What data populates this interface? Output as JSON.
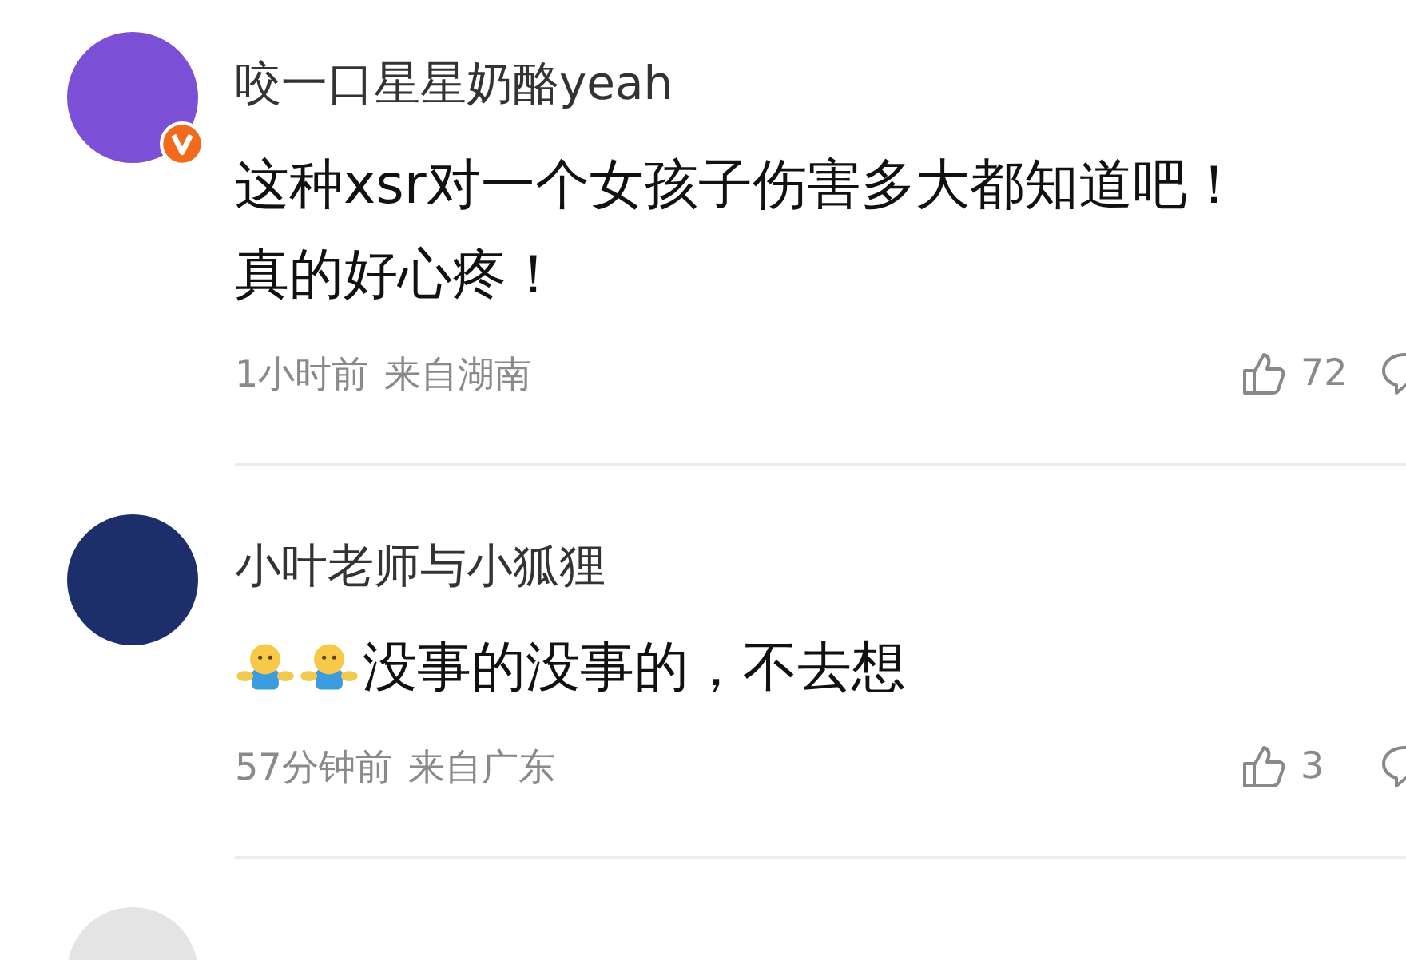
{
  "comments": [
    {
      "name": "咬一口星星奶酪yeah",
      "verified": true,
      "content_lines": [
        [
          {
            "kind": "text",
            "text": "这种xsr对一个女孩子伤害多大都知道吧！"
          }
        ],
        [
          {
            "kind": "text",
            "text": "真的好心疼！"
          }
        ]
      ],
      "time": "1小时前",
      "location": "来自湖南",
      "likes": "72"
    },
    {
      "name": "小叶老师与小狐狸",
      "verified": false,
      "content_lines": [
        [
          {
            "kind": "emoji"
          },
          {
            "kind": "emoji"
          },
          {
            "kind": "text",
            "text": "没事的没事的，不去想"
          }
        ]
      ],
      "time": "57分钟前",
      "location": "来自广东",
      "likes": "3"
    }
  ]
}
